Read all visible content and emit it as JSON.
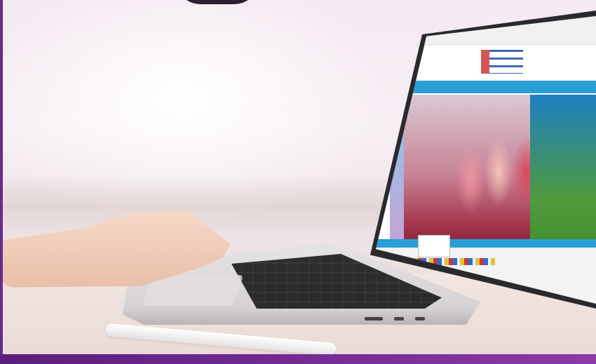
{
  "scene": {
    "description_tags": [
      "laptop",
      "hand",
      "pen",
      "website"
    ],
    "colors": {
      "accent_purple": "#6a2a8a",
      "site_blue": "#2a9fd6",
      "background": "#f4e9f1"
    }
  }
}
